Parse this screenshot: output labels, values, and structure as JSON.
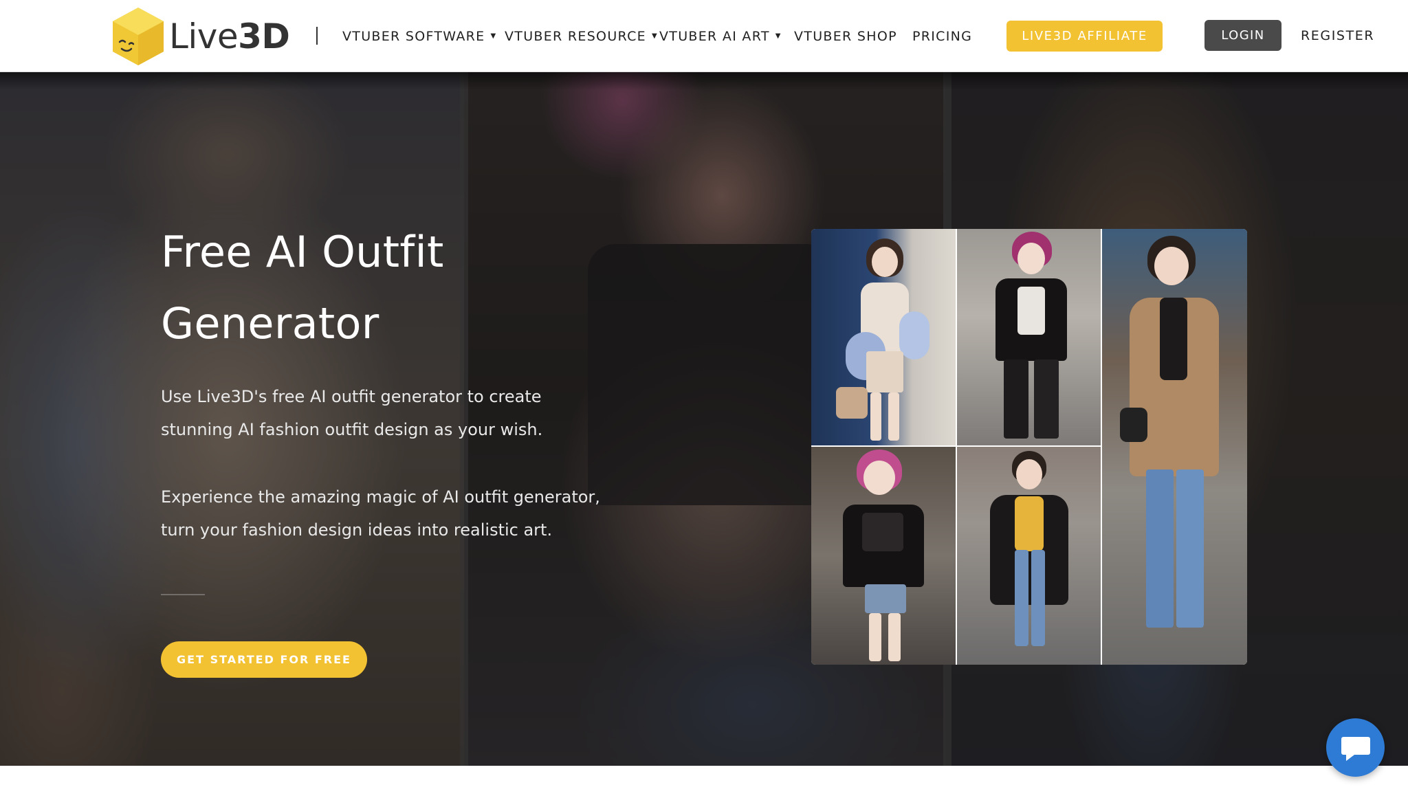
{
  "header": {
    "logo_text_main": "Live",
    "logo_text_accent": "3D",
    "nav": [
      {
        "label": "VTUBER SOFTWARE",
        "has_dropdown": true
      },
      {
        "label": "VTUBER RESOURCE",
        "has_dropdown": true
      },
      {
        "label": "VTUBER AI ART",
        "has_dropdown": true
      },
      {
        "label": "VTUBER SHOP",
        "has_dropdown": false
      },
      {
        "label": "PRICING",
        "has_dropdown": false
      }
    ],
    "affiliate_label": "LIVE3D AFFILIATE",
    "login_label": "LOGIN",
    "register_label": "REGISTER"
  },
  "hero": {
    "title_line1": "Free AI Outfit",
    "title_line2": "Generator",
    "description_1": "Use Live3D's free AI outfit generator to create stunning AI fashion outfit design as your wish.",
    "description_2": "Experience the amazing magic of AI outfit generator, turn your fashion design ideas into realistic art.",
    "cta_label": "GET STARTED FOR FREE"
  },
  "colors": {
    "accent": "#f3c232",
    "login_bg": "#4a4a4a",
    "chat": "#2e7bd6"
  },
  "icons": {
    "logo": "cube-face-icon",
    "dropdown": "caret-down-icon",
    "chat": "chat-bubble-icon"
  }
}
